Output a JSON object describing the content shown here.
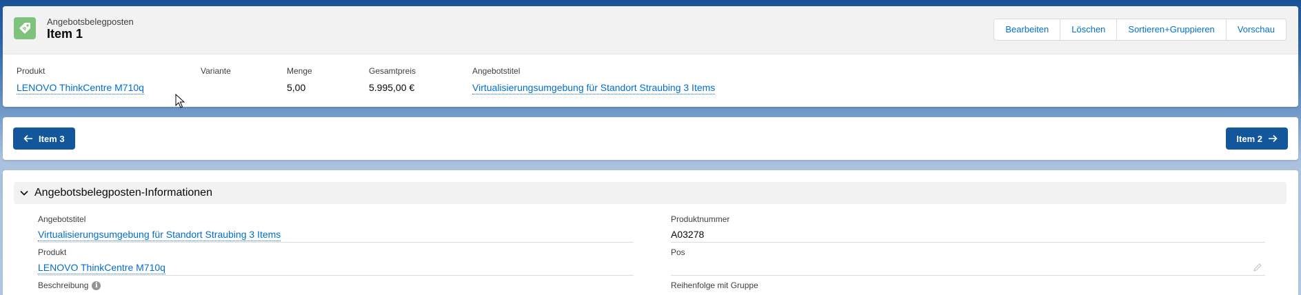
{
  "header": {
    "object_type": "Angebotsbelegposten",
    "record_title": "Item 1",
    "icon": "price-tag-icon",
    "actions": [
      "Bearbeiten",
      "Löschen",
      "Sortieren+Gruppieren",
      "Vorschau"
    ],
    "highlights": [
      {
        "label": "Produkt",
        "value": "LENOVO ThinkCentre M710q",
        "link": true
      },
      {
        "label": "Variante",
        "value": "",
        "link": false
      },
      {
        "label": "Menge",
        "value": "5,00",
        "link": false
      },
      {
        "label": "Gesamtpreis",
        "value": "5.995,00 €",
        "link": false
      },
      {
        "label": "Angebotstitel",
        "value": "Virtualisierungsumgebung für Standort Straubing 3 Items",
        "link": true
      }
    ]
  },
  "navigation": {
    "prev_label": "Item 3",
    "next_label": "Item 2"
  },
  "details": {
    "section_title": "Angebotsbelegposten-Informationen",
    "left": [
      {
        "label": "Angebotstitel",
        "value": "Virtualisierungsumgebung für Standort Straubing 3 Items",
        "link": true
      },
      {
        "label": "Produkt",
        "value": "LENOVO ThinkCentre M710q",
        "link": true
      },
      {
        "label": "Beschreibung",
        "value": "",
        "link": false
      }
    ],
    "right": [
      {
        "label": "Produktnummer",
        "value": "A03278",
        "link": false
      },
      {
        "label": "Pos",
        "value": "",
        "link": false
      },
      {
        "label": "Reihenfolge mit Gruppe",
        "value": "",
        "link": false
      }
    ]
  },
  "colors": {
    "brand_button": "#14569b",
    "link": "#006dcc",
    "icon_bg": "#7dc37d"
  }
}
